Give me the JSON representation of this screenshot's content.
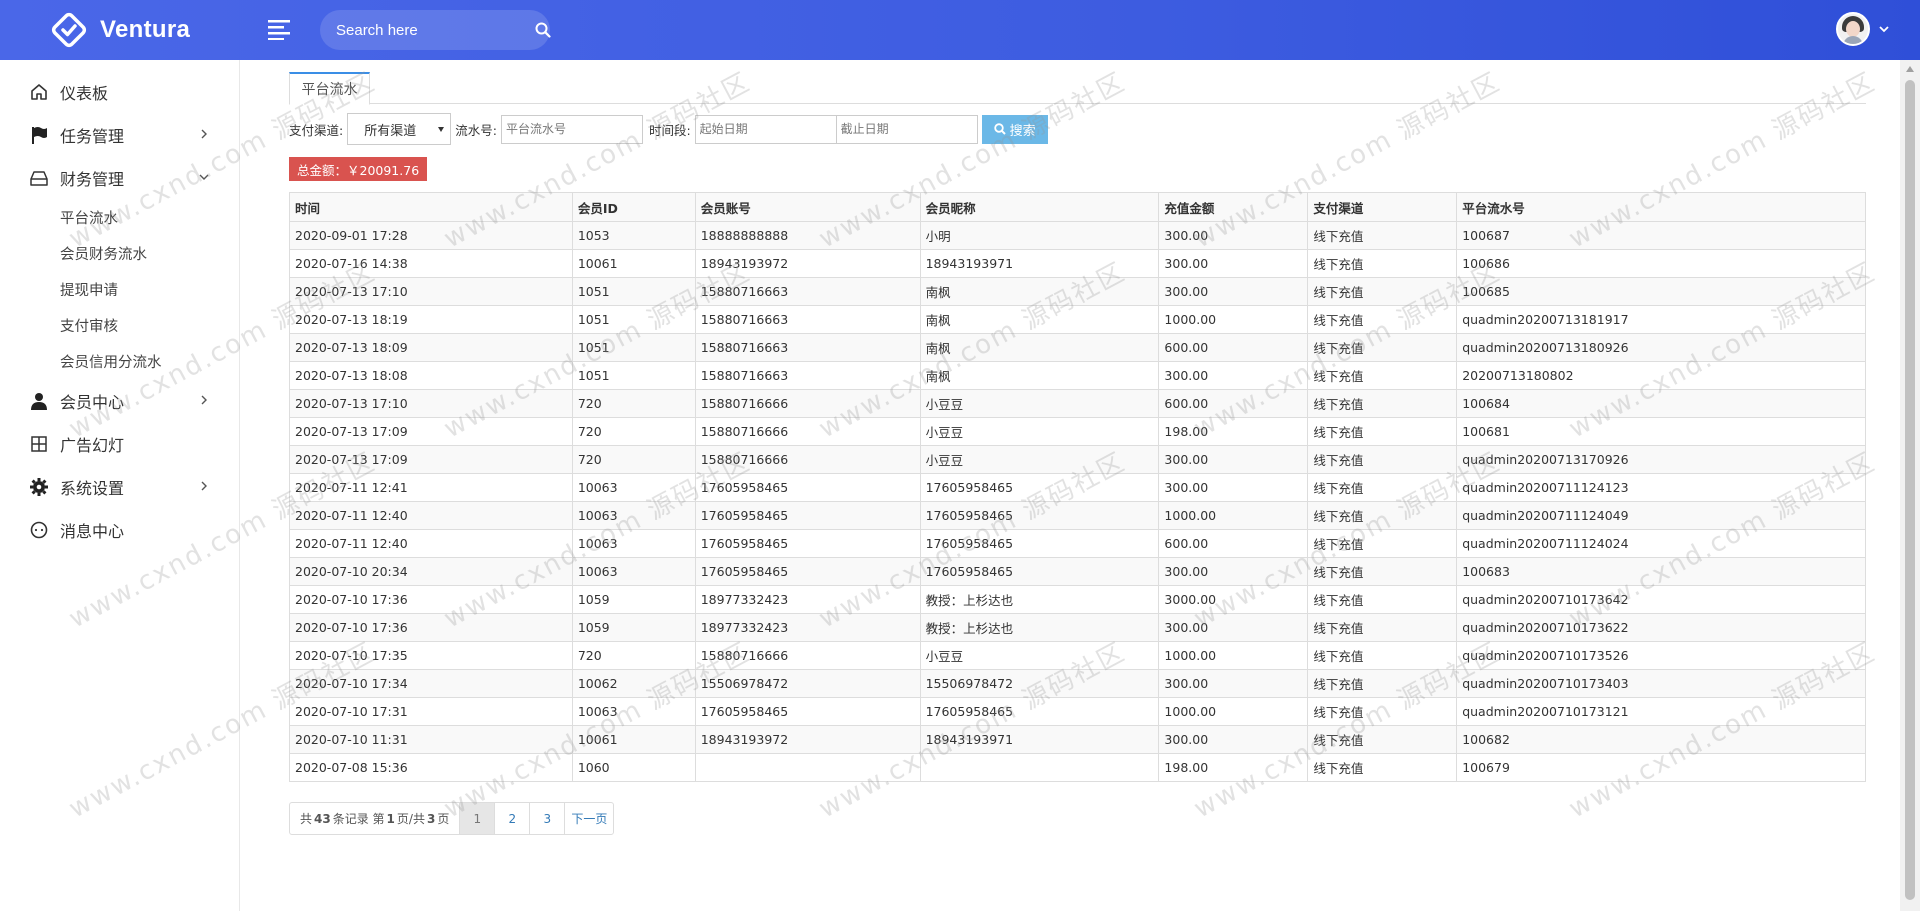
{
  "header": {
    "brand": "Ventura",
    "search_placeholder": "Search here"
  },
  "sidebar": {
    "items": [
      {
        "label": "仪表板",
        "icon": "home-icon"
      },
      {
        "label": "任务管理",
        "icon": "flag-icon"
      },
      {
        "label": "财务管理",
        "icon": "inbox-icon"
      },
      {
        "label": "会员中心",
        "icon": "user-icon"
      },
      {
        "label": "广告幻灯",
        "icon": "grid-icon"
      },
      {
        "label": "系统设置",
        "icon": "gear-icon"
      },
      {
        "label": "消息中心",
        "icon": "chat-icon"
      }
    ],
    "finance_sub": [
      "平台流水",
      "会员财务流水",
      "提现申请",
      "支付审核",
      "会员信用分流水"
    ]
  },
  "tabs": {
    "active": "平台流水"
  },
  "filters": {
    "channel_label": "支付渠道:",
    "channel_value": "所有渠道",
    "serial_label": "流水号:",
    "serial_placeholder": "平台流水号",
    "period_label": "时间段:",
    "start_placeholder": "起始日期",
    "end_placeholder": "截止日期",
    "search_button": "搜索"
  },
  "total": "总金额：￥20091.76",
  "table": {
    "columns": [
      "时间",
      "会员ID",
      "会员账号",
      "会员昵称",
      "充值金额",
      "支付渠道",
      "平台流水号"
    ],
    "rows": [
      [
        "2020-09-01 17:28",
        "1053",
        "18888888888",
        "小明",
        "300.00",
        "线下充值",
        "100687"
      ],
      [
        "2020-07-16 14:38",
        "10061",
        "18943193972",
        "18943193971",
        "300.00",
        "线下充值",
        "100686"
      ],
      [
        "2020-07-13 17:10",
        "1051",
        "15880716663",
        "南枫",
        "300.00",
        "线下充值",
        "100685"
      ],
      [
        "2020-07-13 18:19",
        "1051",
        "15880716663",
        "南枫",
        "1000.00",
        "线下充值",
        "quadmin20200713181917"
      ],
      [
        "2020-07-13 18:09",
        "1051",
        "15880716663",
        "南枫",
        "600.00",
        "线下充值",
        "quadmin20200713180926"
      ],
      [
        "2020-07-13 18:08",
        "1051",
        "15880716663",
        "南枫",
        "300.00",
        "线下充值",
        "20200713180802"
      ],
      [
        "2020-07-13 17:10",
        "720",
        "15880716666",
        "小豆豆",
        "600.00",
        "线下充值",
        "100684"
      ],
      [
        "2020-07-13 17:09",
        "720",
        "15880716666",
        "小豆豆",
        "198.00",
        "线下充值",
        "100681"
      ],
      [
        "2020-07-13 17:09",
        "720",
        "15880716666",
        "小豆豆",
        "300.00",
        "线下充值",
        "quadmin20200713170926"
      ],
      [
        "2020-07-11 12:41",
        "10063",
        "17605958465",
        "17605958465",
        "300.00",
        "线下充值",
        "quadmin20200711124123"
      ],
      [
        "2020-07-11 12:40",
        "10063",
        "17605958465",
        "17605958465",
        "1000.00",
        "线下充值",
        "quadmin20200711124049"
      ],
      [
        "2020-07-11 12:40",
        "10063",
        "17605958465",
        "17605958465",
        "600.00",
        "线下充值",
        "quadmin20200711124024"
      ],
      [
        "2020-07-10 20:34",
        "10063",
        "17605958465",
        "17605958465",
        "300.00",
        "线下充值",
        "100683"
      ],
      [
        "2020-07-10 17:36",
        "1059",
        "18977332423",
        "教授：上杉达也",
        "3000.00",
        "线下充值",
        "quadmin20200710173642"
      ],
      [
        "2020-07-10 17:36",
        "1059",
        "18977332423",
        "教授：上杉达也",
        "300.00",
        "线下充值",
        "quadmin20200710173622"
      ],
      [
        "2020-07-10 17:35",
        "720",
        "15880716666",
        "小豆豆",
        "1000.00",
        "线下充值",
        "quadmin20200710173526"
      ],
      [
        "2020-07-10 17:34",
        "10062",
        "15506978472",
        "15506978472",
        "300.00",
        "线下充值",
        "quadmin20200710173403"
      ],
      [
        "2020-07-10 17:31",
        "10063",
        "17605958465",
        "17605958465",
        "1000.00",
        "线下充值",
        "quadmin20200710173121"
      ],
      [
        "2020-07-10 11:31",
        "10061",
        "18943193972",
        "18943193971",
        "300.00",
        "线下充值",
        "100682"
      ],
      [
        "2020-07-08 15:36",
        "1060",
        "",
        "",
        "198.00",
        "线下充值",
        "100679"
      ]
    ]
  },
  "pagination": {
    "total_records": "43",
    "current_page": "1",
    "total_pages": "3",
    "pages": [
      "1",
      "2",
      "3"
    ],
    "next": "下一页",
    "t1": "共",
    "t2": "条记录 第",
    "t3": "页/共",
    "t4": "页"
  },
  "watermark": {
    "text": "www.cxnd.com 源码社区"
  },
  "colors": {
    "header": "#3d5ce0",
    "badge": "#d9534f",
    "search_button": "#6bb8e7",
    "active_tab_border": "#3a8ee6"
  }
}
